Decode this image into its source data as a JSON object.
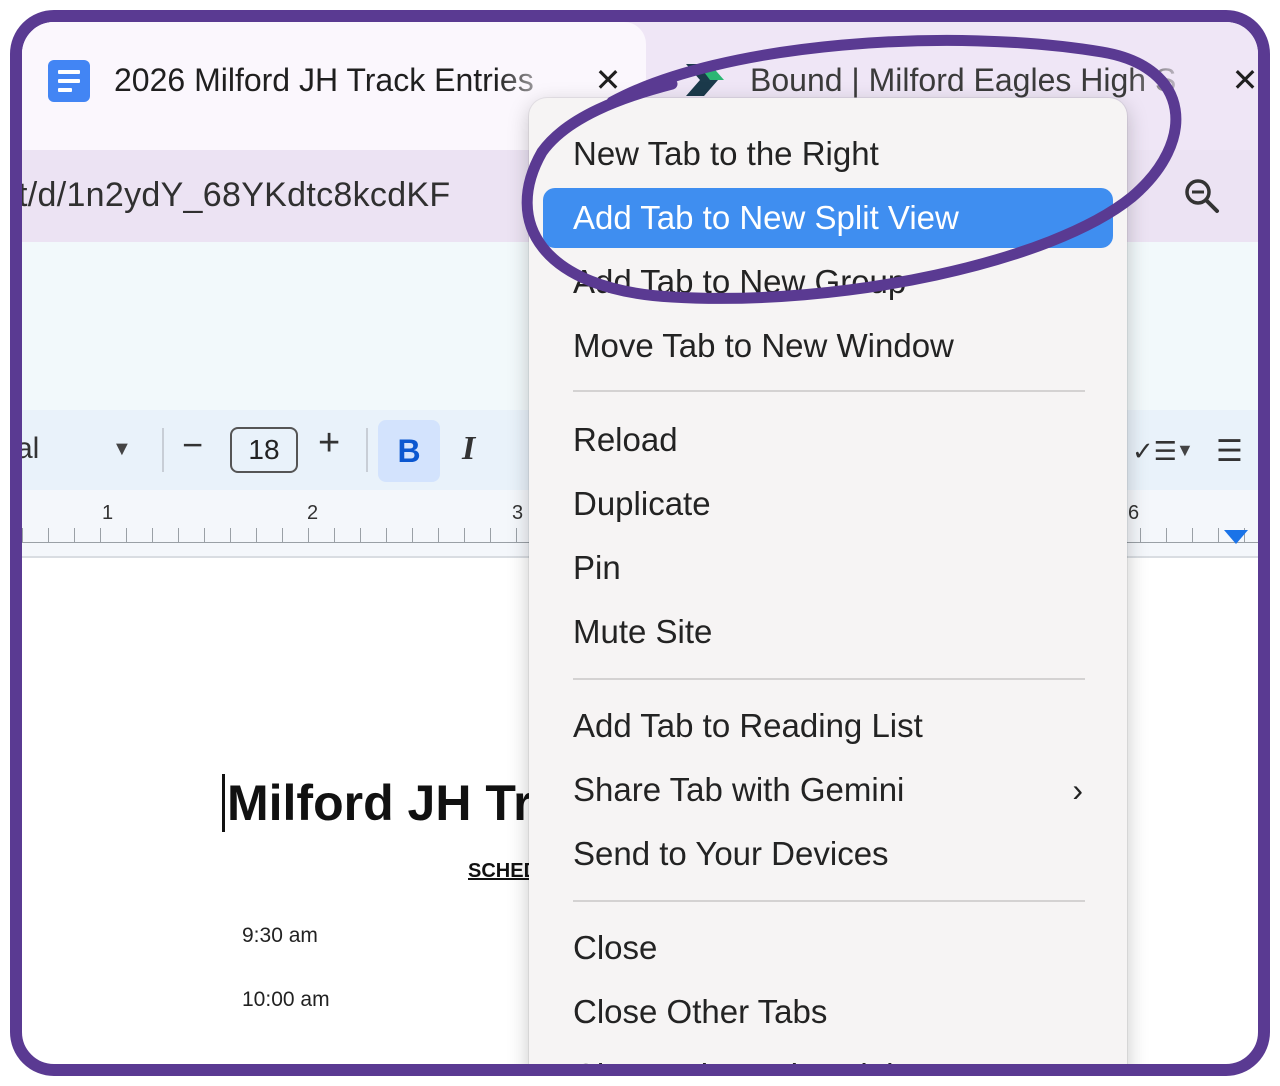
{
  "tabs": [
    {
      "title": "2026 Milford JH Track Entries",
      "close": "✕",
      "icon": "google-docs-icon"
    },
    {
      "title": "Bound | Milford Eagles High S",
      "close": "✕",
      "icon": "bound-logo-icon"
    }
  ],
  "address_bar": {
    "url_fragment": "t/d/1n2ydY_68YKdtc8kcdKF",
    "zoom_icon": "zoom-out-icon",
    "more_icon": "chevron-down-icon"
  },
  "toolbar": {
    "font_name": "al",
    "font_size": "18",
    "minus": "−",
    "plus": "+",
    "bold": "B",
    "italic": "I",
    "checklist": "✓☰",
    "bulleted_list": "☰"
  },
  "ruler": {
    "numbers": [
      "1",
      "2",
      "3",
      "6"
    ]
  },
  "document": {
    "title": "Milford JH Tr",
    "schedule_heading": "SCHED",
    "times": [
      "9:30 am",
      "10:00 am"
    ]
  },
  "context_menu": {
    "items": [
      {
        "label": "New Tab to the Right"
      },
      {
        "label": "Add Tab to New Split View",
        "highlighted": true
      },
      {
        "label": "Add Tab to New Group"
      },
      {
        "label": "Move Tab to New Window"
      },
      {
        "label": "Reload"
      },
      {
        "label": "Duplicate"
      },
      {
        "label": "Pin"
      },
      {
        "label": "Mute Site"
      },
      {
        "label": "Add Tab to Reading List"
      },
      {
        "label": "Share Tab with Gemini",
        "submenu": true
      },
      {
        "label": "Send to Your Devices"
      },
      {
        "label": "Close"
      },
      {
        "label": "Close Other Tabs"
      },
      {
        "label": "Close Tabs to the Right"
      }
    ],
    "submenu_arrow": "›",
    "highlight_color": "#3f8ef0"
  },
  "colors": {
    "frame": "#5a3a92",
    "annotation": "#5a3a92",
    "tabstrip": "#efe6f6",
    "docs_blue": "#4285f4"
  }
}
